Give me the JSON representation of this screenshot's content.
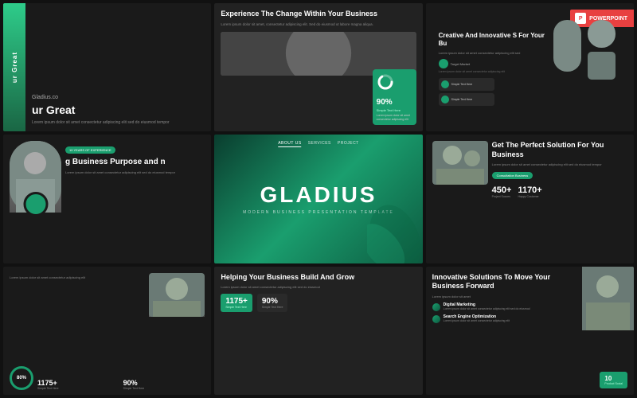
{
  "slides": [
    {
      "id": "slide-1",
      "logo": "Gladius.co",
      "side_text": "ur Great",
      "main_text": "ur Great",
      "desc": "Lorem ipsum dolor sit amet consectetur adipiscing elit sed do eiusmod tempor"
    },
    {
      "id": "slide-2",
      "title": "Experience The Change Within Your Business",
      "body": "Lorem ipsum dolor sit amet, consectetur adipiscing elit. Sed do eiusmod ut labore magna aliqua.",
      "card": {
        "percent": "90%",
        "label": "Simple Text Here",
        "desc": "Lorem ipsum dolor sit amet consectetur adipiscing elit"
      }
    },
    {
      "id": "slide-3",
      "title": "Creative And Innovative S For Your Bu",
      "desc": "Lorem ipsum dolor sit amet consectetur adipiscing elit sed",
      "target_label": "Target Market",
      "ppt_label": "POWERPOINT",
      "stat1": "Simple Text Here",
      "stat2": "Simple Text Here"
    },
    {
      "id": "slide-4",
      "tag": "10 YEARS OF EXPERIENCE",
      "title": "g Business Purpose and n",
      "desc": "Lorem ipsum dolor sit amet consectetur adipiscing elit sed do eiusmod tempor"
    },
    {
      "id": "slide-5",
      "nav_items": [
        "ABOUT US",
        "SERVICES",
        "PROJECT"
      ],
      "big_title": "GLADIUS",
      "sub": "MODERN BUSINESS PRESENTATION TEMPLATE"
    },
    {
      "id": "slide-6",
      "title": "Get The Perfect Solution For You Business",
      "desc": "Lorem ipsum dolor sit amet consectetur adipiscing elit sed do eiusmod tempor",
      "consult_label": "Consultation Business",
      "stat1_num": "450+",
      "stat1_lbl": "Project Succes",
      "stat2_num": "1170+",
      "stat2_lbl": "Happy Customer"
    },
    {
      "id": "slide-7",
      "desc": "Lorem ipsum dolor sit amet consectetur adipiscing elit",
      "circle_val": "80%",
      "stat1_num": "1175+",
      "stat1_lbl": "Simple Text Here",
      "stat2_num": "90%",
      "stat2_lbl": "Simple Text Here"
    },
    {
      "id": "slide-8",
      "title": "Helping Your Business Build And Grow",
      "desc": "Lorem ipsum dolor sit amet consectetur adipiscing elit sed do eiusmod",
      "stat1_num": "1175+",
      "stat1_lbl": "Simple Text Here",
      "stat2_num": "90%",
      "stat2_lbl": "Simple Text Here"
    },
    {
      "id": "slide-9",
      "title": "Innovative Solutions To Move Your Business Forward",
      "desc": "Lorem ipsum dolor sit amet",
      "item1_title": "Digital Marketing",
      "item1_desc": "Lorem ipsum dolor sit amet consectetur adipiscing elit sed do eiusmod",
      "item2_title": "Search Engine Optimization",
      "item2_desc": "Lorem ipsum dolor sit amet consectetur adipiscing elit",
      "badge_num": "10",
      "badge_lbl": "Product Social"
    }
  ],
  "accent_color": "#1a9e6e",
  "ppt_badge_label": "POWERPOINT"
}
